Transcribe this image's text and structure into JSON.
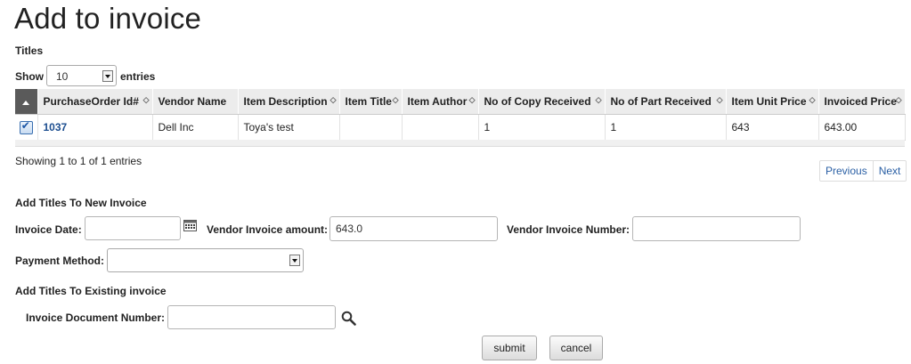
{
  "page": {
    "title": "Add to invoice"
  },
  "titles_section": {
    "heading": "Titles"
  },
  "length_control": {
    "prefix": "Show",
    "value": "10",
    "suffix": "entries"
  },
  "table": {
    "columns": [
      "PurchaseOrder Id#",
      "Vendor Name",
      "Item Description",
      "Item Title",
      "Item Author",
      "No of Copy Received",
      "No of Part Received",
      "Item Unit Price",
      "Invoiced Price"
    ],
    "rows": [
      {
        "checked": true,
        "purchase_order_id": "1037",
        "vendor_name": "Dell Inc",
        "item_description": "Toya's test",
        "item_title": "",
        "item_author": "",
        "copies_received": "1",
        "parts_received": "1",
        "unit_price": "643",
        "invoiced_price": "643.00"
      }
    ],
    "info": "Showing 1 to 1 of 1 entries"
  },
  "pagination": {
    "previous": "Previous",
    "next": "Next"
  },
  "new_invoice": {
    "heading": "Add Titles To New Invoice",
    "invoice_date_label": "Invoice Date:",
    "invoice_date_value": "",
    "vendor_amount_label": "Vendor Invoice amount:",
    "vendor_amount_value": "643.0",
    "vendor_number_label": "Vendor Invoice Number:",
    "vendor_number_value": "",
    "payment_method_label": "Payment Method:",
    "payment_method_value": ""
  },
  "existing_invoice": {
    "heading": "Add Titles To Existing invoice",
    "doc_number_label": "Invoice Document Number:",
    "doc_number_value": ""
  },
  "actions": {
    "submit": "submit",
    "cancel": "cancel"
  },
  "icons": {
    "calendar": "calendar-icon",
    "search": "search-icon"
  }
}
